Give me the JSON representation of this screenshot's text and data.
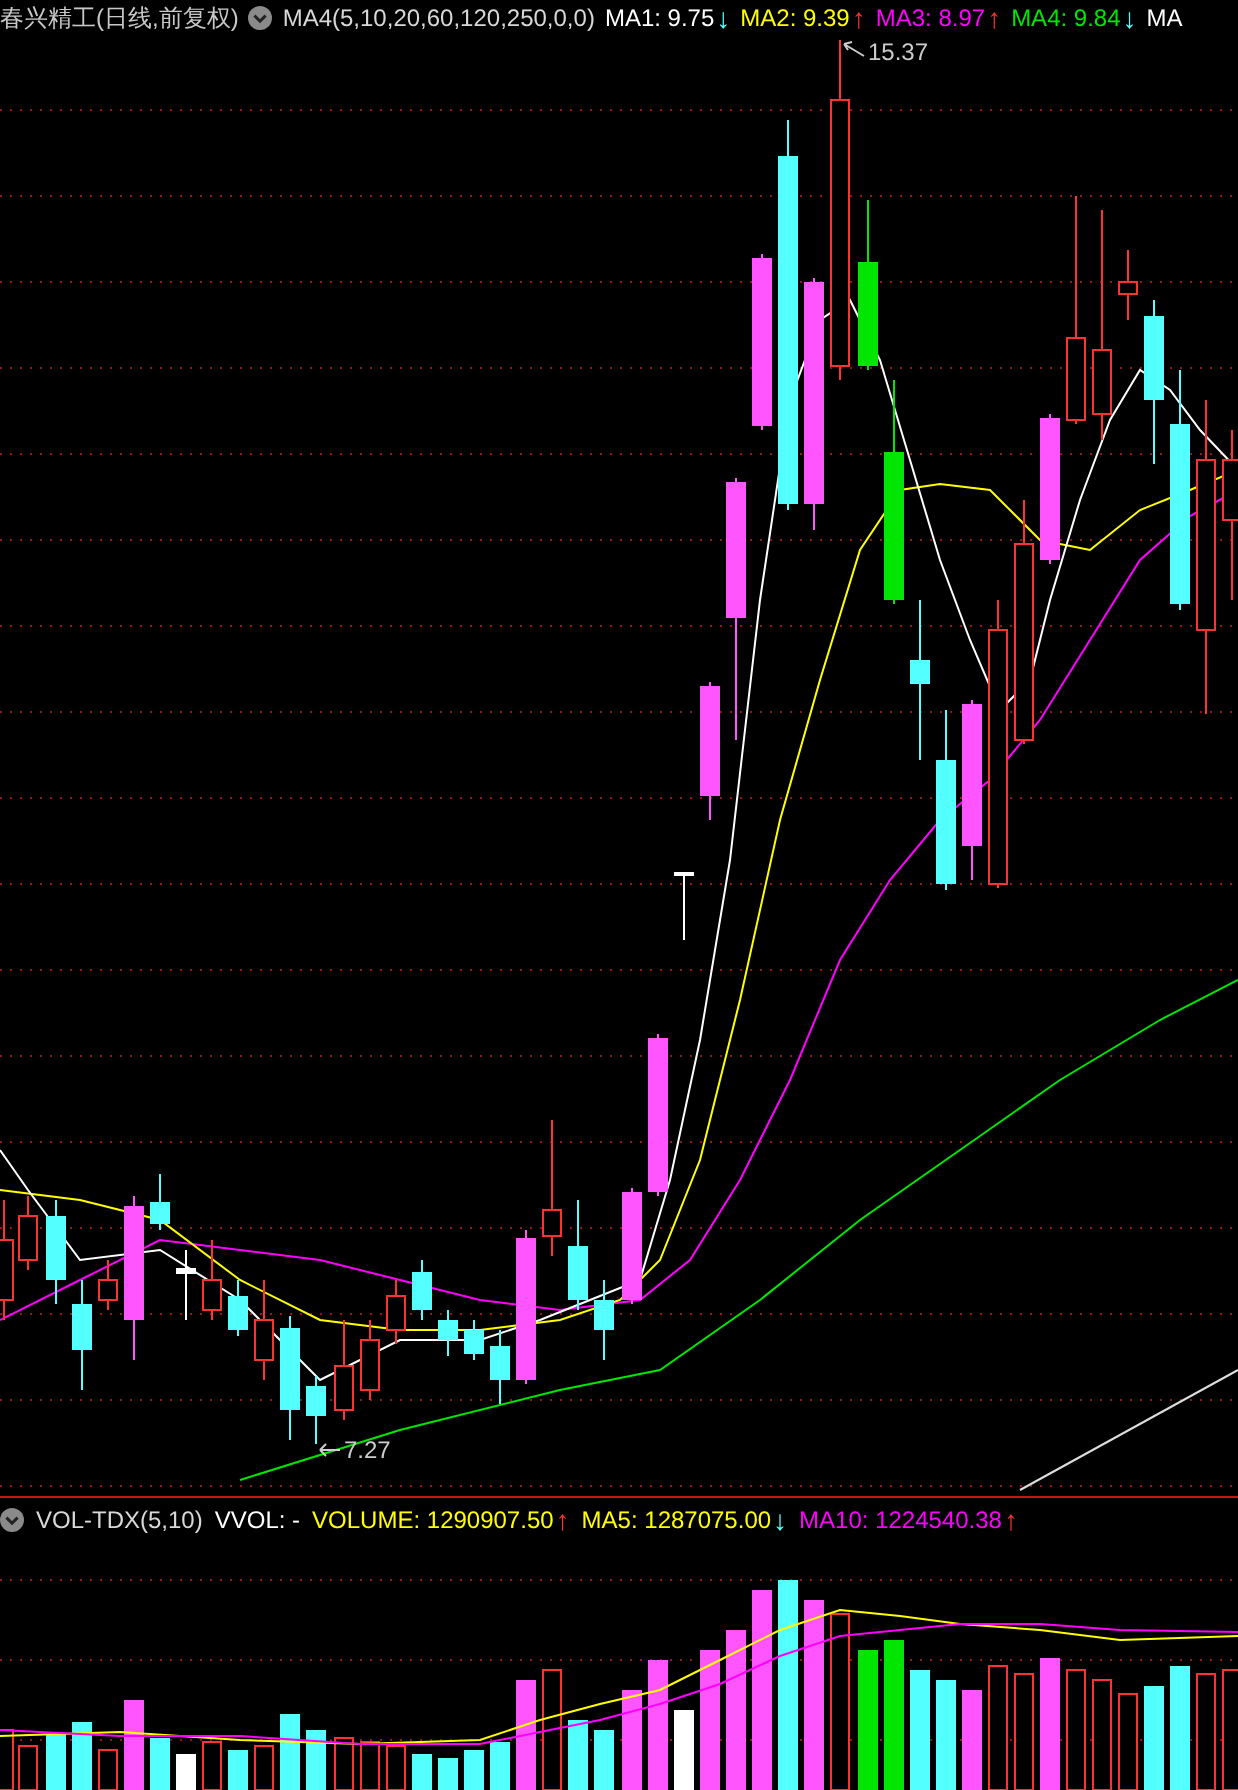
{
  "header": {
    "title": "春兴精工(日线,前复权)",
    "indicator": "MA4(5,10,20,60,120,250,0,0)",
    "readings": [
      {
        "label": "MA1: 9.75",
        "color": "#ffffff",
        "arrow": {
          "symbol": "↓",
          "color": "#54ffff"
        }
      },
      {
        "label": "MA2: 9.39",
        "color": "#ffff00",
        "arrow": {
          "symbol": "↑",
          "color": "#ff3232"
        }
      },
      {
        "label": "MA3: 8.97",
        "color": "#ff00ff",
        "arrow": {
          "symbol": "↑",
          "color": "#ff3232"
        }
      },
      {
        "label": "MA4: 9.84",
        "color": "#00e600",
        "arrow": {
          "symbol": "↓",
          "color": "#54ffff"
        }
      },
      {
        "label": "MA",
        "color": "#ffffff"
      }
    ]
  },
  "price_chart": {
    "high_label": "15.37",
    "low_label": "7.27"
  },
  "volume": {
    "indicator": "VOL-TDX(5,10)",
    "readings": [
      {
        "label": "VVOL: -",
        "color": "#ffffff"
      },
      {
        "label": "VOLUME: 1290907.50",
        "color": "#ffff00",
        "arrow": {
          "symbol": "↑",
          "color": "#ff3232"
        }
      },
      {
        "label": "MA5: 1287075.00",
        "color": "#ffff00",
        "arrow": {
          "symbol": "↓",
          "color": "#54ffff"
        }
      },
      {
        "label": "MA10: 1224540.38",
        "color": "#ff00ff",
        "arrow": {
          "symbol": "↑",
          "color": "#ff3232"
        }
      }
    ]
  }
}
